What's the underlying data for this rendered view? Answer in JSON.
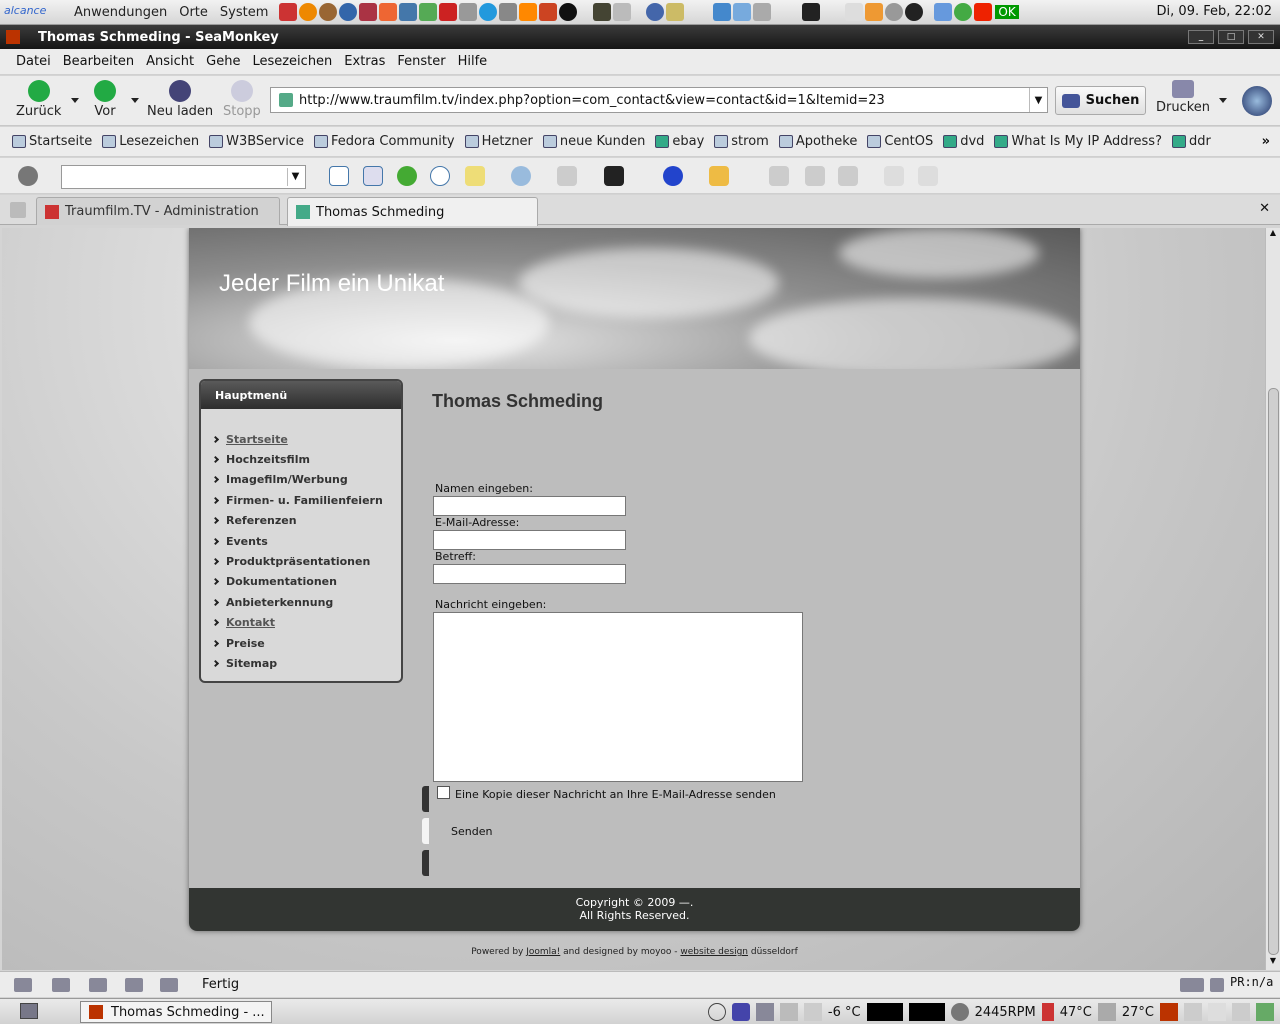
{
  "panel": {
    "menus": [
      "Anwendungen",
      "Orte",
      "System"
    ],
    "clock": "Di, 09. Feb, 22:02",
    "ok_badge": "OK"
  },
  "window": {
    "title": "Thomas Schmeding - SeaMonkey"
  },
  "menubar": [
    "Datei",
    "Bearbeiten",
    "Ansicht",
    "Gehe",
    "Lesezeichen",
    "Extras",
    "Fenster",
    "Hilfe"
  ],
  "toolbar": {
    "back": "Zurück",
    "forward": "Vor",
    "reload": "Neu laden",
    "stop": "Stopp",
    "url": "http://www.traumfilm.tv/index.php?option=com_contact&view=contact&id=1&Itemid=23",
    "search": "Suchen",
    "print": "Drucken"
  },
  "bookmarks": [
    "Startseite",
    "Lesezeichen",
    "W3BService",
    "Fedora Community",
    "Hetzner",
    "neue Kunden",
    "ebay",
    "strom",
    "Apotheke",
    "CentOS",
    "dvd",
    "What Is My IP Address?",
    "ddr"
  ],
  "tabs": [
    {
      "label": "Traumfilm.TV - Administration"
    },
    {
      "label": "Thomas Schmeding"
    }
  ],
  "site": {
    "slogan": "Jeder Film ein Unikat",
    "menu_title": "Hauptmenü",
    "menu": [
      {
        "label": "Startseite",
        "underlined": true
      },
      {
        "label": "Hochzeitsfilm",
        "underlined": false
      },
      {
        "label": "Imagefilm/Werbung",
        "underlined": false
      },
      {
        "label": "Firmen- u. Familienfeiern",
        "underlined": false
      },
      {
        "label": "Referenzen",
        "underlined": false
      },
      {
        "label": "Events",
        "underlined": false
      },
      {
        "label": "Produktpräsentationen",
        "underlined": false
      },
      {
        "label": "Dokumentationen",
        "underlined": false
      },
      {
        "label": "Anbieterkennung",
        "underlined": false
      },
      {
        "label": "Kontakt",
        "underlined": true
      },
      {
        "label": "Preise",
        "underlined": false
      },
      {
        "label": "Sitemap",
        "underlined": false
      }
    ],
    "page_title": "Thomas Schmeding",
    "form": {
      "name_label": "Namen eingeben:",
      "email_label": "E-Mail-Adresse:",
      "subject_label": "Betreff:",
      "message_label": "Nachricht eingeben:",
      "copy_label": "Eine Kopie dieser Nachricht an Ihre E-Mail-Adresse senden",
      "send": "Senden"
    },
    "footer_line1": "Copyright © 2009 —.",
    "footer_line2": "All Rights Reserved.",
    "powered_pre": "Powered by ",
    "powered_joomla": "Joomla!",
    "powered_mid": " and designed by moyoo - ",
    "powered_design": "website design",
    "powered_post": " düsseldorf"
  },
  "status": {
    "text": "Fertig",
    "pr": "PR:n/a"
  },
  "taskbar": {
    "task": "Thomas Schmeding - ...",
    "temp_out": "-6 °C",
    "fan": "2445RPM",
    "cpu_temp": "47°C",
    "hdd_temp": "27°C"
  }
}
